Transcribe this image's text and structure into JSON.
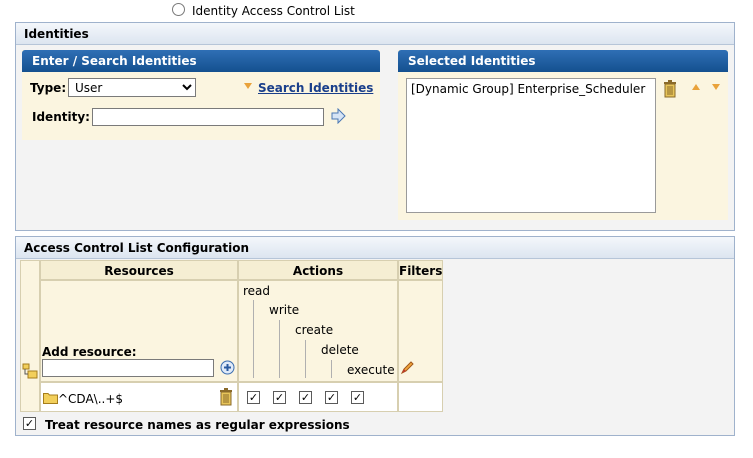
{
  "top": {
    "radio_label": "Identity Access Control List"
  },
  "identities": {
    "title": "Identities",
    "search": {
      "title": "Enter / Search Identities",
      "type_label": "Type:",
      "type_value": "User",
      "search_link": "Search Identities",
      "identity_label": "Identity:",
      "identity_value": ""
    },
    "selected": {
      "title": "Selected Identities",
      "items": [
        "[Dynamic Group] Enterprise_Scheduler"
      ]
    }
  },
  "acl": {
    "title": "Access Control List Configuration",
    "headers": {
      "resources": "Resources",
      "actions": "Actions",
      "filters": "Filters"
    },
    "actions": [
      "read",
      "write",
      "create",
      "delete",
      "execute"
    ],
    "add_resource_label": "Add resource:",
    "add_resource_value": "",
    "rows": [
      {
        "resource": "^CDA\\..+$",
        "checks": [
          true,
          true,
          true,
          true,
          true
        ]
      }
    ],
    "regex_label": "Treat resource names as regular expressions",
    "regex_checked": true
  }
}
